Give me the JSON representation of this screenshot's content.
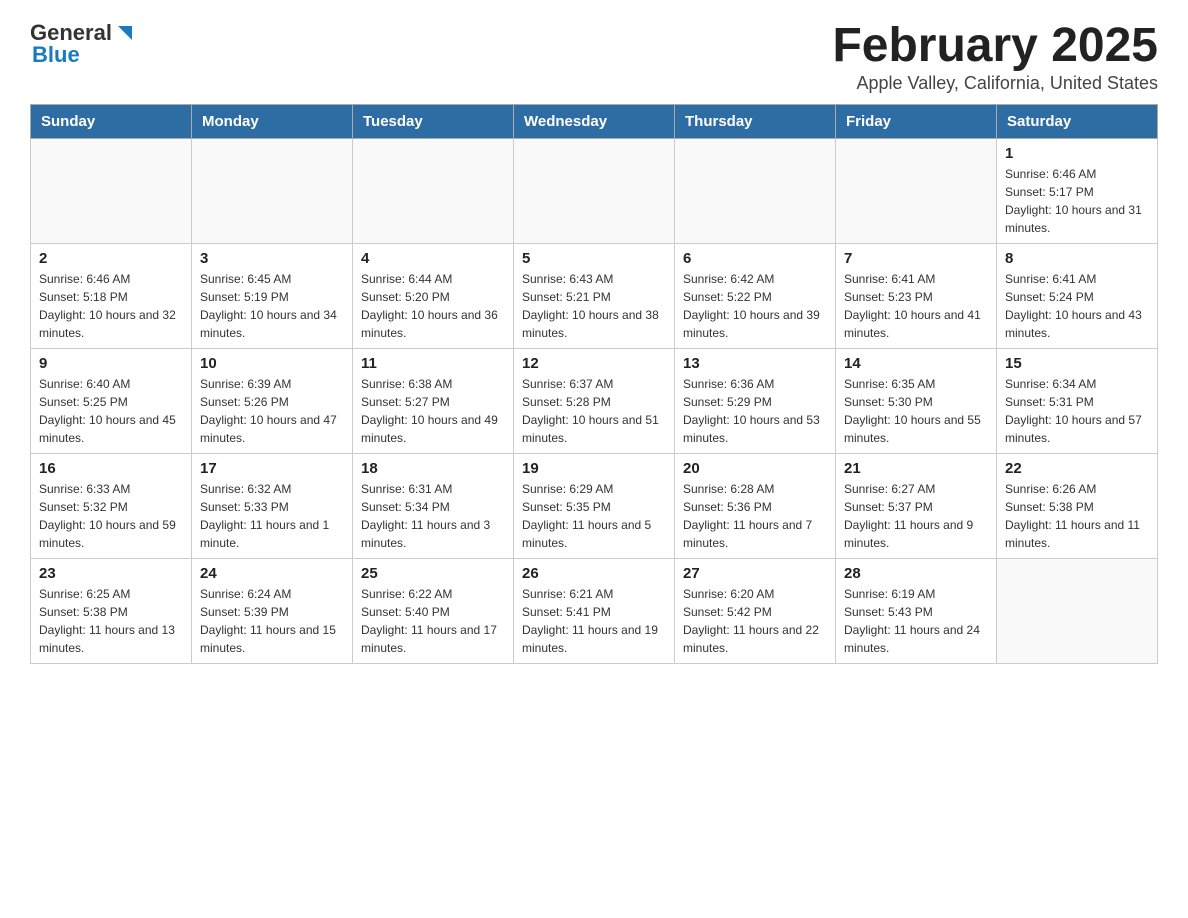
{
  "header": {
    "logo_general": "General",
    "logo_blue": "Blue",
    "title": "February 2025",
    "subtitle": "Apple Valley, California, United States"
  },
  "days_of_week": [
    "Sunday",
    "Monday",
    "Tuesday",
    "Wednesday",
    "Thursday",
    "Friday",
    "Saturday"
  ],
  "weeks": [
    [
      {
        "day": "",
        "info": ""
      },
      {
        "day": "",
        "info": ""
      },
      {
        "day": "",
        "info": ""
      },
      {
        "day": "",
        "info": ""
      },
      {
        "day": "",
        "info": ""
      },
      {
        "day": "",
        "info": ""
      },
      {
        "day": "1",
        "info": "Sunrise: 6:46 AM\nSunset: 5:17 PM\nDaylight: 10 hours and 31 minutes."
      }
    ],
    [
      {
        "day": "2",
        "info": "Sunrise: 6:46 AM\nSunset: 5:18 PM\nDaylight: 10 hours and 32 minutes."
      },
      {
        "day": "3",
        "info": "Sunrise: 6:45 AM\nSunset: 5:19 PM\nDaylight: 10 hours and 34 minutes."
      },
      {
        "day": "4",
        "info": "Sunrise: 6:44 AM\nSunset: 5:20 PM\nDaylight: 10 hours and 36 minutes."
      },
      {
        "day": "5",
        "info": "Sunrise: 6:43 AM\nSunset: 5:21 PM\nDaylight: 10 hours and 38 minutes."
      },
      {
        "day": "6",
        "info": "Sunrise: 6:42 AM\nSunset: 5:22 PM\nDaylight: 10 hours and 39 minutes."
      },
      {
        "day": "7",
        "info": "Sunrise: 6:41 AM\nSunset: 5:23 PM\nDaylight: 10 hours and 41 minutes."
      },
      {
        "day": "8",
        "info": "Sunrise: 6:41 AM\nSunset: 5:24 PM\nDaylight: 10 hours and 43 minutes."
      }
    ],
    [
      {
        "day": "9",
        "info": "Sunrise: 6:40 AM\nSunset: 5:25 PM\nDaylight: 10 hours and 45 minutes."
      },
      {
        "day": "10",
        "info": "Sunrise: 6:39 AM\nSunset: 5:26 PM\nDaylight: 10 hours and 47 minutes."
      },
      {
        "day": "11",
        "info": "Sunrise: 6:38 AM\nSunset: 5:27 PM\nDaylight: 10 hours and 49 minutes."
      },
      {
        "day": "12",
        "info": "Sunrise: 6:37 AM\nSunset: 5:28 PM\nDaylight: 10 hours and 51 minutes."
      },
      {
        "day": "13",
        "info": "Sunrise: 6:36 AM\nSunset: 5:29 PM\nDaylight: 10 hours and 53 minutes."
      },
      {
        "day": "14",
        "info": "Sunrise: 6:35 AM\nSunset: 5:30 PM\nDaylight: 10 hours and 55 minutes."
      },
      {
        "day": "15",
        "info": "Sunrise: 6:34 AM\nSunset: 5:31 PM\nDaylight: 10 hours and 57 minutes."
      }
    ],
    [
      {
        "day": "16",
        "info": "Sunrise: 6:33 AM\nSunset: 5:32 PM\nDaylight: 10 hours and 59 minutes."
      },
      {
        "day": "17",
        "info": "Sunrise: 6:32 AM\nSunset: 5:33 PM\nDaylight: 11 hours and 1 minute."
      },
      {
        "day": "18",
        "info": "Sunrise: 6:31 AM\nSunset: 5:34 PM\nDaylight: 11 hours and 3 minutes."
      },
      {
        "day": "19",
        "info": "Sunrise: 6:29 AM\nSunset: 5:35 PM\nDaylight: 11 hours and 5 minutes."
      },
      {
        "day": "20",
        "info": "Sunrise: 6:28 AM\nSunset: 5:36 PM\nDaylight: 11 hours and 7 minutes."
      },
      {
        "day": "21",
        "info": "Sunrise: 6:27 AM\nSunset: 5:37 PM\nDaylight: 11 hours and 9 minutes."
      },
      {
        "day": "22",
        "info": "Sunrise: 6:26 AM\nSunset: 5:38 PM\nDaylight: 11 hours and 11 minutes."
      }
    ],
    [
      {
        "day": "23",
        "info": "Sunrise: 6:25 AM\nSunset: 5:38 PM\nDaylight: 11 hours and 13 minutes."
      },
      {
        "day": "24",
        "info": "Sunrise: 6:24 AM\nSunset: 5:39 PM\nDaylight: 11 hours and 15 minutes."
      },
      {
        "day": "25",
        "info": "Sunrise: 6:22 AM\nSunset: 5:40 PM\nDaylight: 11 hours and 17 minutes."
      },
      {
        "day": "26",
        "info": "Sunrise: 6:21 AM\nSunset: 5:41 PM\nDaylight: 11 hours and 19 minutes."
      },
      {
        "day": "27",
        "info": "Sunrise: 6:20 AM\nSunset: 5:42 PM\nDaylight: 11 hours and 22 minutes."
      },
      {
        "day": "28",
        "info": "Sunrise: 6:19 AM\nSunset: 5:43 PM\nDaylight: 11 hours and 24 minutes."
      },
      {
        "day": "",
        "info": ""
      }
    ]
  ]
}
